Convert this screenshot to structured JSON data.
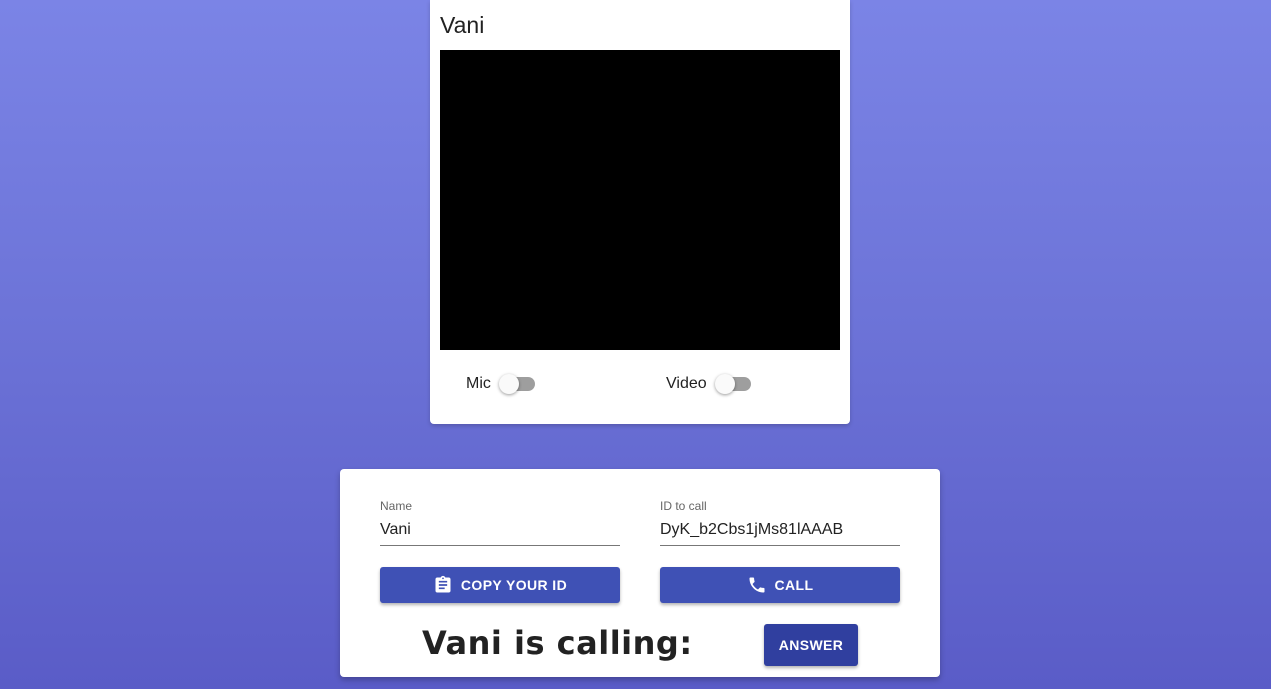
{
  "video_card": {
    "title": "Vani",
    "mic_label": "Mic",
    "video_label": "Video",
    "mic_on": false,
    "video_on": false
  },
  "controls": {
    "name_label": "Name",
    "name_value": "Vani",
    "id_label": "ID to call",
    "id_value": "DyK_b2Cbs1jMs81lAAAB",
    "copy_button": "COPY YOUR ID",
    "call_button": "CALL",
    "calling_text": "Vani is calling:",
    "answer_button": "ANSWER"
  },
  "icons": {
    "copy": "clipboard-icon",
    "call": "phone-icon"
  },
  "colors": {
    "primary": "#3f51b5",
    "answer": "#303f9f",
    "background_top": "#7b84e6",
    "background_bottom": "#5a5cc7"
  }
}
